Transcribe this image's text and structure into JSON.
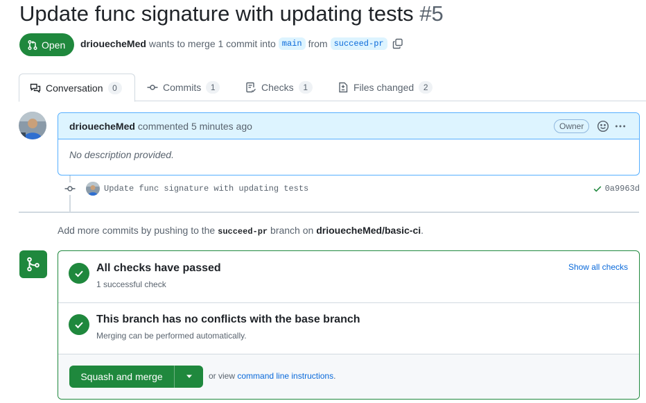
{
  "pr": {
    "title": "Update func signature with updating tests",
    "number": "#5",
    "state": "Open",
    "author": "driouecheMed",
    "action_text": "wants to merge 1 commit into",
    "base_branch": "main",
    "from_text": "from",
    "head_branch": "succeed-pr"
  },
  "tabs": [
    {
      "label": "Conversation",
      "count": "0",
      "icon": "comment-discussion-icon"
    },
    {
      "label": "Commits",
      "count": "1",
      "icon": "git-commit-icon"
    },
    {
      "label": "Checks",
      "count": "1",
      "icon": "checklist-icon"
    },
    {
      "label": "Files changed",
      "count": "2",
      "icon": "file-diff-icon"
    }
  ],
  "comment": {
    "author": "driouecheMed",
    "time": "commented 5 minutes ago",
    "badge": "Owner",
    "body": "No description provided."
  },
  "commit": {
    "message": "Update func signature with updating tests",
    "sha": "0a9963d"
  },
  "hint": {
    "prefix": "Add more commits by pushing to the",
    "branch": "succeed-pr",
    "middle": "branch on",
    "repo": "driouecheMed/basic-ci",
    "suffix": "."
  },
  "merge": {
    "checks_title": "All checks have passed",
    "checks_sub": "1 successful check",
    "show_checks": "Show all checks",
    "conflicts_title": "This branch has no conflicts with the base branch",
    "conflicts_sub": "Merging can be performed automatically.",
    "button_label": "Squash and merge",
    "or_view": "or view",
    "cli_link": "command line instructions",
    "period": "."
  },
  "colors": {
    "green": "#1f883d",
    "link": "#0969da",
    "header_blue": "#ddf4ff"
  }
}
